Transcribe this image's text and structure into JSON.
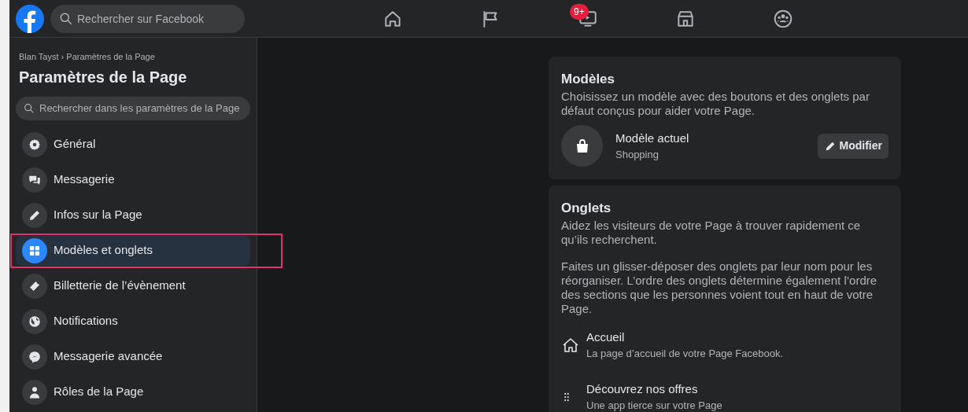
{
  "topbar": {
    "search": {
      "placeholder": "Rechercher sur Facebook"
    },
    "video_badge": "9+"
  },
  "sidebar": {
    "breadcrumb": "Blan Tayst › Paramètres de la Page",
    "title": "Paramètres de la Page",
    "search": {
      "placeholder": "Rechercher dans les paramètres de la Page"
    },
    "items": [
      {
        "label": "Général",
        "selected": false
      },
      {
        "label": "Messagerie",
        "selected": false
      },
      {
        "label": "Infos sur la Page",
        "selected": false
      },
      {
        "label": "Modèles et onglets",
        "selected": true
      },
      {
        "label": "Billetterie de l’évènement",
        "selected": false
      },
      {
        "label": "Notifications",
        "selected": false
      },
      {
        "label": "Messagerie avancée",
        "selected": false
      },
      {
        "label": "Rôles de la Page",
        "selected": false
      }
    ]
  },
  "highlight": {
    "color": "#e0336b"
  },
  "templates_card": {
    "title": "Modèles",
    "description": "Choisissez un modèle avec des boutons et des onglets par défaut conçus pour aider votre Page.",
    "current_label": "Modèle actuel",
    "current_value": "Shopping",
    "button": "Modifier"
  },
  "tabs_card": {
    "title": "Onglets",
    "paragraphs": [
      "Aidez les visiteurs de votre Page à trouver rapidement ce qu’ils recherchent.",
      "Faites un glisser-déposer des onglets par leur nom pour les réorganiser. L’ordre des onglets détermine également l’ordre des sections que les personnes voient tout en haut de votre Page."
    ],
    "tabs": [
      {
        "title": "Accueil",
        "description": "La page d’accueil de votre Page Facebook."
      },
      {
        "title": "Découvrez nos offres",
        "description": "Une app tierce sur votre Page"
      }
    ]
  }
}
